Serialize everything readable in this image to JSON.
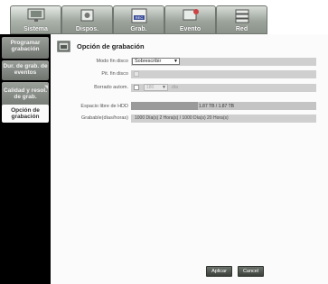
{
  "top_tabs": [
    {
      "label": "Sistema",
      "icon": "monitor-icon",
      "active": true
    },
    {
      "label": "Dispos.",
      "icon": "devices-icon",
      "active": false
    },
    {
      "label": "Grab.",
      "icon": "record-icon",
      "active": false
    },
    {
      "label": "Evento",
      "icon": "event-icon",
      "active": false
    },
    {
      "label": "Red",
      "icon": "network-icon",
      "active": false
    }
  ],
  "sidebar": {
    "items": [
      {
        "label": "Programar grabación"
      },
      {
        "label": "Dur. de grab. de eventos"
      },
      {
        "label": "Calidad y resol. de grab."
      },
      {
        "label": "Opción de grabación",
        "active": true
      }
    ]
  },
  "main": {
    "title": "Opción de grabación",
    "modo_label": "Modo fin disco",
    "modo_value": "Sobrescribir",
    "pit_label": "Pit. fin disco",
    "borrado_label": "Borrado autom.",
    "borrado_days": "180",
    "borrado_unit": "día",
    "hdd_label": "Espacio libre de HDD",
    "hdd_value": "1.87 TB / 1.87 TB",
    "hdd_fraction": 0.36,
    "rec_label": "Grabable(días/horas)",
    "rec_value": "1000 Día(s) 2 Hora(s) / 1000 Día(s) 20 Hora(s)"
  },
  "buttons": {
    "apply": "Aplicar",
    "cancel": "Cancel"
  }
}
